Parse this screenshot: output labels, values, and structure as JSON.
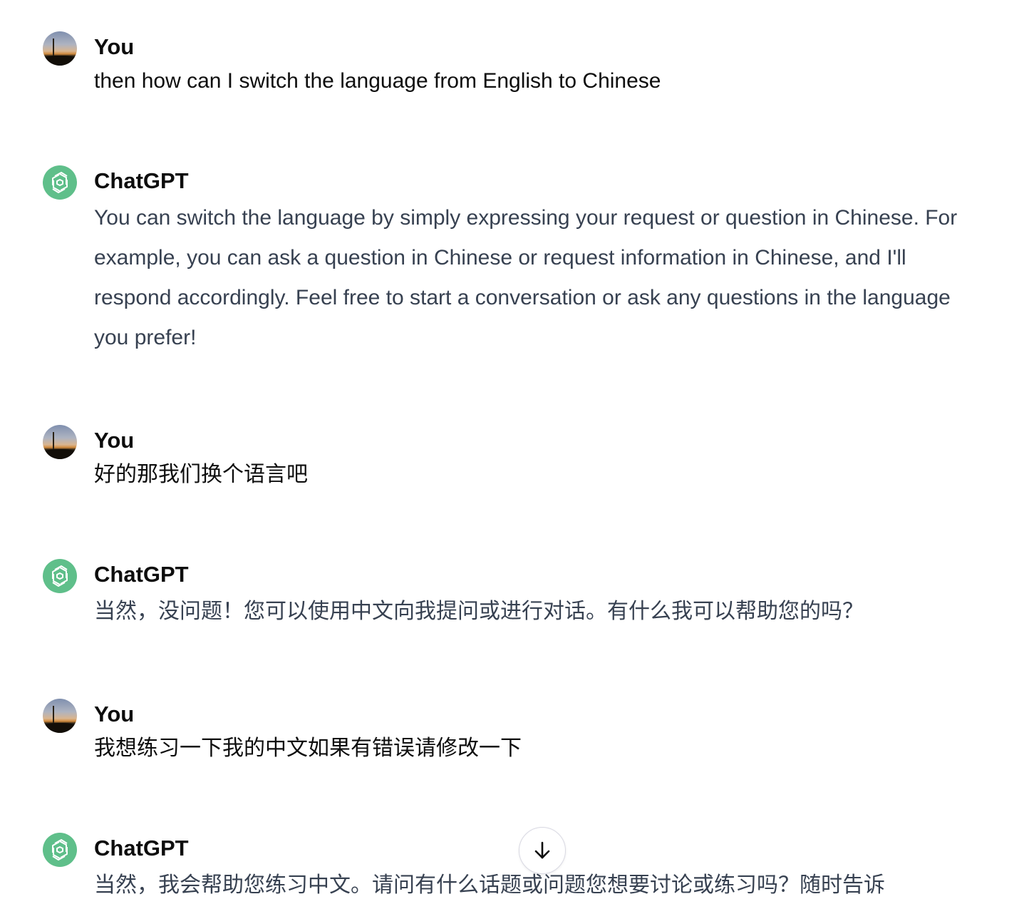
{
  "colors": {
    "text": "#0d0d0d",
    "assistant_text": "#374151",
    "gpt_avatar_bg": "#5fbf8a",
    "scroll_button_border": "#d9d9e3"
  },
  "messages": [
    {
      "role": "user",
      "author": "You",
      "avatar_icon": "user-photo-avatar",
      "text": "then how can I switch the language from English to Chinese"
    },
    {
      "role": "assistant",
      "author": "ChatGPT",
      "avatar_icon": "openai-logo-icon",
      "text": "You can switch the language by simply expressing your request or question in Chinese. For example, you can ask a question in Chinese or request information in Chinese, and I'll respond accordingly. Feel free to start a conversation or ask any questions in the language you prefer!"
    },
    {
      "role": "user",
      "author": "You",
      "avatar_icon": "user-photo-avatar",
      "text": "好的那我们换个语言吧"
    },
    {
      "role": "assistant",
      "author": "ChatGPT",
      "avatar_icon": "openai-logo-icon",
      "text": "当然，没问题！您可以使用中文向我提问或进行对话。有什么我可以帮助您的吗？"
    },
    {
      "role": "user",
      "author": "You",
      "avatar_icon": "user-photo-avatar",
      "text": "我想练习一下我的中文如果有错误请修改一下"
    },
    {
      "role": "assistant",
      "author": "ChatGPT",
      "avatar_icon": "openai-logo-icon",
      "text": "当然，我会帮助您练习中文。请问有什么话题或问题您想要讨论或练习吗？随时告诉"
    }
  ],
  "scroll_button": {
    "icon": "arrow-down-icon"
  }
}
